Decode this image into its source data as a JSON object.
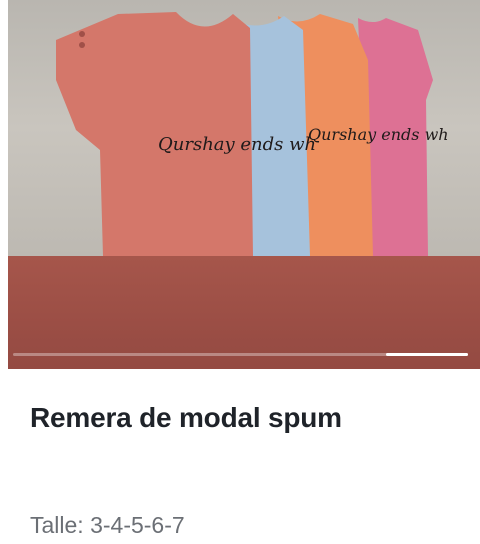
{
  "product": {
    "title": "Remera de modal spum",
    "sizes_label": "Talle: 3-4-5-6-7"
  },
  "gallery": {
    "image_alt_icon": "product-photo-tshirts",
    "shirt_colors": [
      "#d4776a",
      "#a6c2dc",
      "#ee8f5e",
      "#dd7194"
    ],
    "background_color": "#9a534a",
    "print_text": [
      "Qurshay ends wh",
      "Qurshay ends wh"
    ],
    "slide_progress_start": 0.82,
    "slide_progress_end": 1.0
  }
}
